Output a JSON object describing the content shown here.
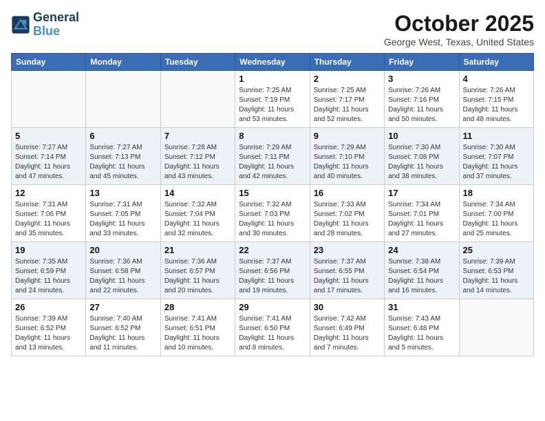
{
  "header": {
    "logo_line1": "General",
    "logo_line2": "Blue",
    "month": "October 2025",
    "location": "George West, Texas, United States"
  },
  "weekdays": [
    "Sunday",
    "Monday",
    "Tuesday",
    "Wednesday",
    "Thursday",
    "Friday",
    "Saturday"
  ],
  "weeks": [
    [
      {
        "day": "",
        "sunrise": "",
        "sunset": "",
        "daylight": "",
        "empty": true
      },
      {
        "day": "",
        "sunrise": "",
        "sunset": "",
        "daylight": "",
        "empty": true
      },
      {
        "day": "",
        "sunrise": "",
        "sunset": "",
        "daylight": "",
        "empty": true
      },
      {
        "day": "1",
        "sunrise": "Sunrise: 7:25 AM",
        "sunset": "Sunset: 7:19 PM",
        "daylight": "Daylight: 11 hours and 53 minutes.",
        "empty": false
      },
      {
        "day": "2",
        "sunrise": "Sunrise: 7:25 AM",
        "sunset": "Sunset: 7:17 PM",
        "daylight": "Daylight: 11 hours and 52 minutes.",
        "empty": false
      },
      {
        "day": "3",
        "sunrise": "Sunrise: 7:26 AM",
        "sunset": "Sunset: 7:16 PM",
        "daylight": "Daylight: 11 hours and 50 minutes.",
        "empty": false
      },
      {
        "day": "4",
        "sunrise": "Sunrise: 7:26 AM",
        "sunset": "Sunset: 7:15 PM",
        "daylight": "Daylight: 11 hours and 48 minutes.",
        "empty": false
      }
    ],
    [
      {
        "day": "5",
        "sunrise": "Sunrise: 7:27 AM",
        "sunset": "Sunset: 7:14 PM",
        "daylight": "Daylight: 11 hours and 47 minutes.",
        "empty": false
      },
      {
        "day": "6",
        "sunrise": "Sunrise: 7:27 AM",
        "sunset": "Sunset: 7:13 PM",
        "daylight": "Daylight: 11 hours and 45 minutes.",
        "empty": false
      },
      {
        "day": "7",
        "sunrise": "Sunrise: 7:28 AM",
        "sunset": "Sunset: 7:12 PM",
        "daylight": "Daylight: 11 hours and 43 minutes.",
        "empty": false
      },
      {
        "day": "8",
        "sunrise": "Sunrise: 7:29 AM",
        "sunset": "Sunset: 7:11 PM",
        "daylight": "Daylight: 11 hours and 42 minutes.",
        "empty": false
      },
      {
        "day": "9",
        "sunrise": "Sunrise: 7:29 AM",
        "sunset": "Sunset: 7:10 PM",
        "daylight": "Daylight: 11 hours and 40 minutes.",
        "empty": false
      },
      {
        "day": "10",
        "sunrise": "Sunrise: 7:30 AM",
        "sunset": "Sunset: 7:08 PM",
        "daylight": "Daylight: 11 hours and 38 minutes.",
        "empty": false
      },
      {
        "day": "11",
        "sunrise": "Sunrise: 7:30 AM",
        "sunset": "Sunset: 7:07 PM",
        "daylight": "Daylight: 11 hours and 37 minutes.",
        "empty": false
      }
    ],
    [
      {
        "day": "12",
        "sunrise": "Sunrise: 7:31 AM",
        "sunset": "Sunset: 7:06 PM",
        "daylight": "Daylight: 11 hours and 35 minutes.",
        "empty": false
      },
      {
        "day": "13",
        "sunrise": "Sunrise: 7:31 AM",
        "sunset": "Sunset: 7:05 PM",
        "daylight": "Daylight: 11 hours and 33 minutes.",
        "empty": false
      },
      {
        "day": "14",
        "sunrise": "Sunrise: 7:32 AM",
        "sunset": "Sunset: 7:04 PM",
        "daylight": "Daylight: 11 hours and 32 minutes.",
        "empty": false
      },
      {
        "day": "15",
        "sunrise": "Sunrise: 7:32 AM",
        "sunset": "Sunset: 7:03 PM",
        "daylight": "Daylight: 11 hours and 30 minutes.",
        "empty": false
      },
      {
        "day": "16",
        "sunrise": "Sunrise: 7:33 AM",
        "sunset": "Sunset: 7:02 PM",
        "daylight": "Daylight: 11 hours and 28 minutes.",
        "empty": false
      },
      {
        "day": "17",
        "sunrise": "Sunrise: 7:34 AM",
        "sunset": "Sunset: 7:01 PM",
        "daylight": "Daylight: 11 hours and 27 minutes.",
        "empty": false
      },
      {
        "day": "18",
        "sunrise": "Sunrise: 7:34 AM",
        "sunset": "Sunset: 7:00 PM",
        "daylight": "Daylight: 11 hours and 25 minutes.",
        "empty": false
      }
    ],
    [
      {
        "day": "19",
        "sunrise": "Sunrise: 7:35 AM",
        "sunset": "Sunset: 6:59 PM",
        "daylight": "Daylight: 11 hours and 24 minutes.",
        "empty": false
      },
      {
        "day": "20",
        "sunrise": "Sunrise: 7:36 AM",
        "sunset": "Sunset: 6:58 PM",
        "daylight": "Daylight: 11 hours and 22 minutes.",
        "empty": false
      },
      {
        "day": "21",
        "sunrise": "Sunrise: 7:36 AM",
        "sunset": "Sunset: 6:57 PM",
        "daylight": "Daylight: 11 hours and 20 minutes.",
        "empty": false
      },
      {
        "day": "22",
        "sunrise": "Sunrise: 7:37 AM",
        "sunset": "Sunset: 6:56 PM",
        "daylight": "Daylight: 11 hours and 19 minutes.",
        "empty": false
      },
      {
        "day": "23",
        "sunrise": "Sunrise: 7:37 AM",
        "sunset": "Sunset: 6:55 PM",
        "daylight": "Daylight: 11 hours and 17 minutes.",
        "empty": false
      },
      {
        "day": "24",
        "sunrise": "Sunrise: 7:38 AM",
        "sunset": "Sunset: 6:54 PM",
        "daylight": "Daylight: 11 hours and 16 minutes.",
        "empty": false
      },
      {
        "day": "25",
        "sunrise": "Sunrise: 7:39 AM",
        "sunset": "Sunset: 6:53 PM",
        "daylight": "Daylight: 11 hours and 14 minutes.",
        "empty": false
      }
    ],
    [
      {
        "day": "26",
        "sunrise": "Sunrise: 7:39 AM",
        "sunset": "Sunset: 6:52 PM",
        "daylight": "Daylight: 11 hours and 13 minutes.",
        "empty": false
      },
      {
        "day": "27",
        "sunrise": "Sunrise: 7:40 AM",
        "sunset": "Sunset: 6:52 PM",
        "daylight": "Daylight: 11 hours and 11 minutes.",
        "empty": false
      },
      {
        "day": "28",
        "sunrise": "Sunrise: 7:41 AM",
        "sunset": "Sunset: 6:51 PM",
        "daylight": "Daylight: 11 hours and 10 minutes.",
        "empty": false
      },
      {
        "day": "29",
        "sunrise": "Sunrise: 7:41 AM",
        "sunset": "Sunset: 6:50 PM",
        "daylight": "Daylight: 11 hours and 8 minutes.",
        "empty": false
      },
      {
        "day": "30",
        "sunrise": "Sunrise: 7:42 AM",
        "sunset": "Sunset: 6:49 PM",
        "daylight": "Daylight: 11 hours and 7 minutes.",
        "empty": false
      },
      {
        "day": "31",
        "sunrise": "Sunrise: 7:43 AM",
        "sunset": "Sunset: 6:48 PM",
        "daylight": "Daylight: 11 hours and 5 minutes.",
        "empty": false
      },
      {
        "day": "",
        "sunrise": "",
        "sunset": "",
        "daylight": "",
        "empty": true
      }
    ]
  ]
}
